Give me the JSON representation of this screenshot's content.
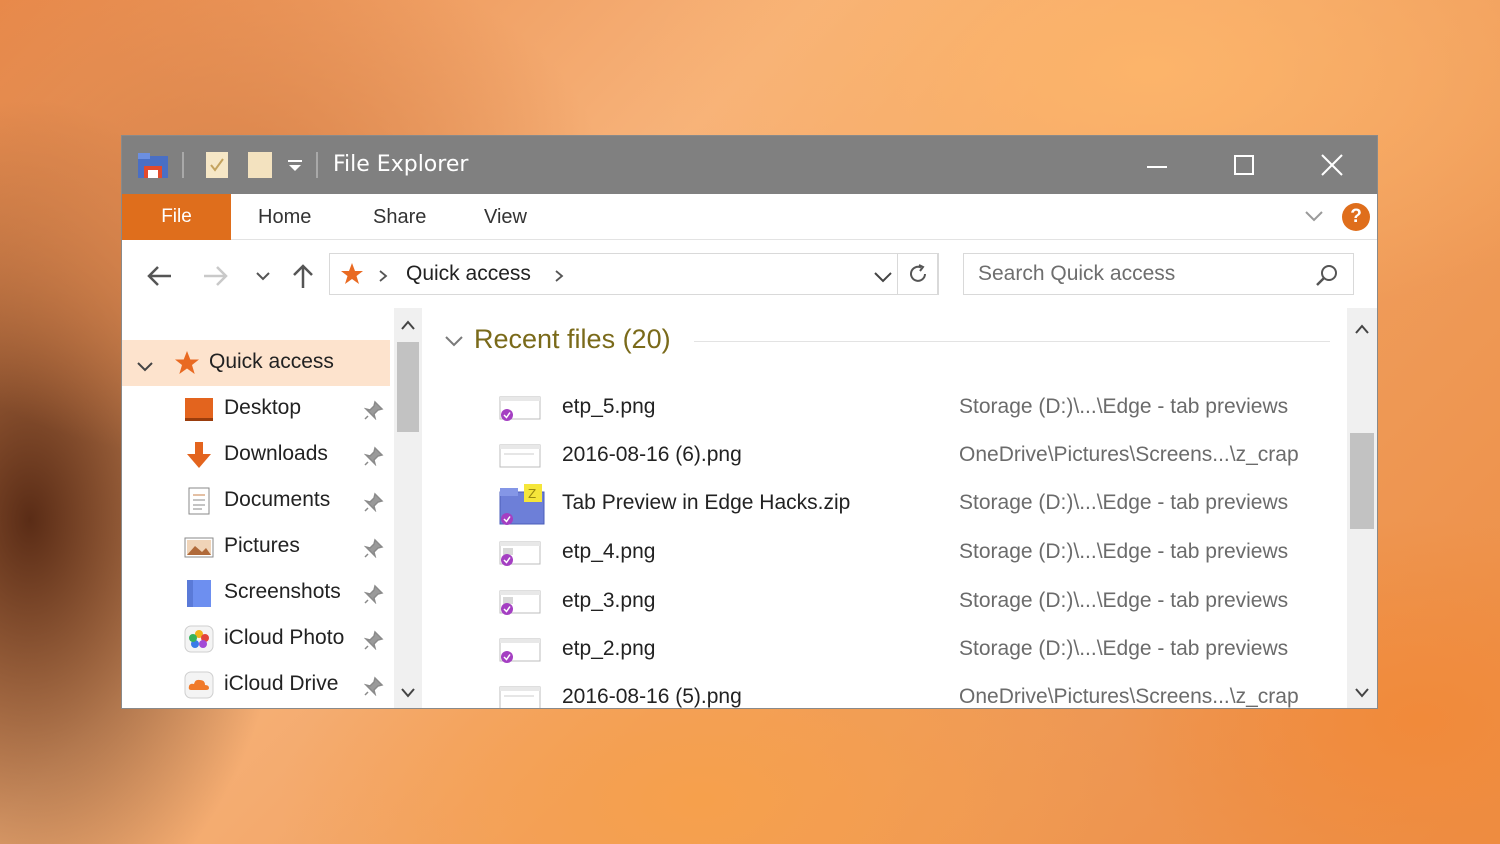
{
  "window": {
    "title": "File Explorer"
  },
  "ribbon": {
    "tabs": [
      "File",
      "Home",
      "Share",
      "View"
    ],
    "help_label": "?"
  },
  "address": {
    "breadcrumb": "Quick access",
    "search_placeholder": "Search Quick access"
  },
  "nav": {
    "root": "Quick access",
    "items": [
      {
        "label": "Desktop",
        "icon": "desktop-icon",
        "pinned": true
      },
      {
        "label": "Downloads",
        "icon": "downloads-icon",
        "pinned": true
      },
      {
        "label": "Documents",
        "icon": "documents-icon",
        "pinned": true
      },
      {
        "label": "Pictures",
        "icon": "pictures-icon",
        "pinned": true
      },
      {
        "label": "Screenshots",
        "icon": "folder-icon",
        "pinned": true
      },
      {
        "label": "iCloud Photo",
        "icon": "icloud-photos-icon",
        "pinned": true
      },
      {
        "label": "iCloud Drive",
        "icon": "icloud-drive-icon",
        "pinned": true
      }
    ]
  },
  "content": {
    "group_title": "Recent files (20)",
    "files": [
      {
        "name": "etp_5.png",
        "path": "Storage (D:)\\...\\Edge - tab previews",
        "icon": "image-file-icon"
      },
      {
        "name": "2016-08-16 (6).png",
        "path": "OneDrive\\Pictures\\Screens...\\z_crap",
        "icon": "image-file-icon"
      },
      {
        "name": "Tab Preview in Edge Hacks.zip",
        "path": "Storage (D:)\\...\\Edge - tab previews",
        "icon": "zip-file-icon"
      },
      {
        "name": "etp_4.png",
        "path": "Storage (D:)\\...\\Edge - tab previews",
        "icon": "image-file-icon"
      },
      {
        "name": "etp_3.png",
        "path": "Storage (D:)\\...\\Edge - tab previews",
        "icon": "image-file-icon"
      },
      {
        "name": "etp_2.png",
        "path": "Storage (D:)\\...\\Edge - tab previews",
        "icon": "image-file-icon"
      },
      {
        "name": "2016-08-16 (5).png",
        "path": "OneDrive\\Pictures\\Screens...\\z_crap",
        "icon": "image-file-icon"
      }
    ]
  },
  "colors": {
    "accent": "#df6e1c",
    "titlebar": "#808080",
    "selected": "#fde3cd",
    "group_title": "#7a6a1a"
  }
}
